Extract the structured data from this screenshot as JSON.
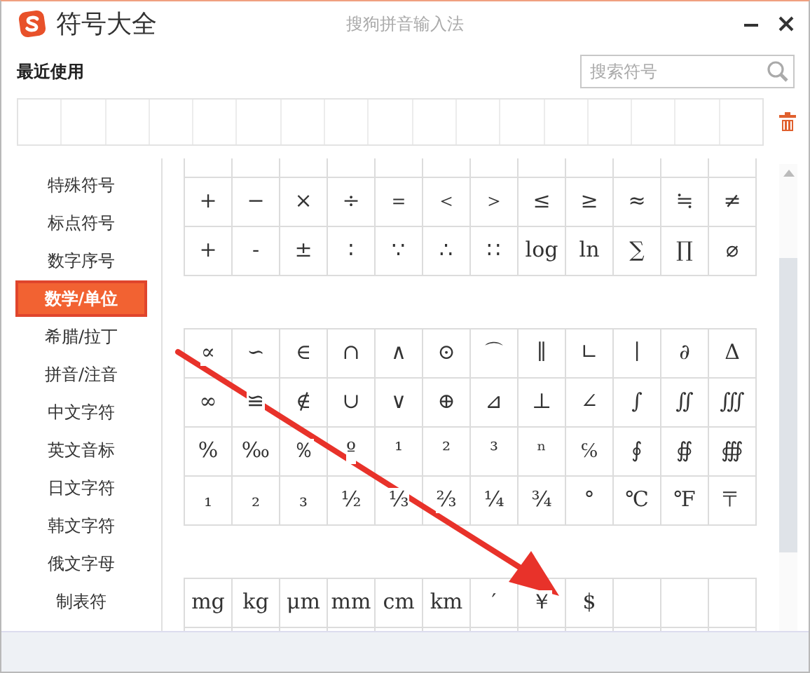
{
  "window": {
    "title": "符号大全",
    "subtitle": "搜狗拼音输入法"
  },
  "recent": {
    "label": "最近使用"
  },
  "search": {
    "placeholder": "搜索符号"
  },
  "categories": [
    {
      "label": "特殊符号",
      "selected": false
    },
    {
      "label": "标点符号",
      "selected": false
    },
    {
      "label": "数字序号",
      "selected": false
    },
    {
      "label": "数学/单位",
      "selected": true
    },
    {
      "label": "希腊/拉丁",
      "selected": false
    },
    {
      "label": "拼音/注音",
      "selected": false
    },
    {
      "label": "中文字符",
      "selected": false
    },
    {
      "label": "英文音标",
      "selected": false
    },
    {
      "label": "日文字符",
      "selected": false
    },
    {
      "label": "韩文字符",
      "selected": false
    },
    {
      "label": "俄文字母",
      "selected": false
    },
    {
      "label": "制表符",
      "selected": false
    }
  ],
  "symbol_groups": [
    {
      "rows": [
        [
          "+",
          "−",
          "×",
          "÷",
          "＝",
          "＜",
          "＞",
          "≤",
          "≥",
          "≈",
          "≒",
          "≠"
        ],
        [
          "+",
          "-",
          "±",
          "∶",
          "∵",
          "∴",
          "∷",
          "log",
          "ln",
          "∑",
          "∏",
          "⌀"
        ]
      ]
    },
    {
      "rows": [
        [
          "∝",
          "∽",
          "∈",
          "∩",
          "∧",
          "⊙",
          "⌒",
          "∥",
          "∟",
          "∣",
          "∂",
          "Δ"
        ],
        [
          "∞",
          "≌",
          "∉",
          "∪",
          "∨",
          "⊕",
          "⊿",
          "⊥",
          "∠",
          "∫",
          "∬",
          "∭"
        ],
        [
          "%",
          "‰",
          "％",
          "º",
          "¹",
          "²",
          "³",
          "ⁿ",
          "℅",
          "∮",
          "∯",
          "∰"
        ],
        [
          "₁",
          "₂",
          "₃",
          "½",
          "⅓",
          "⅔",
          "¼",
          "¾",
          "°",
          "℃",
          "℉",
          "〒"
        ]
      ]
    },
    {
      "rows": [
        [
          "mg",
          "kg",
          "μm",
          "mm",
          "cm",
          "km",
          "′",
          "￥",
          "$"
        ]
      ]
    }
  ]
}
